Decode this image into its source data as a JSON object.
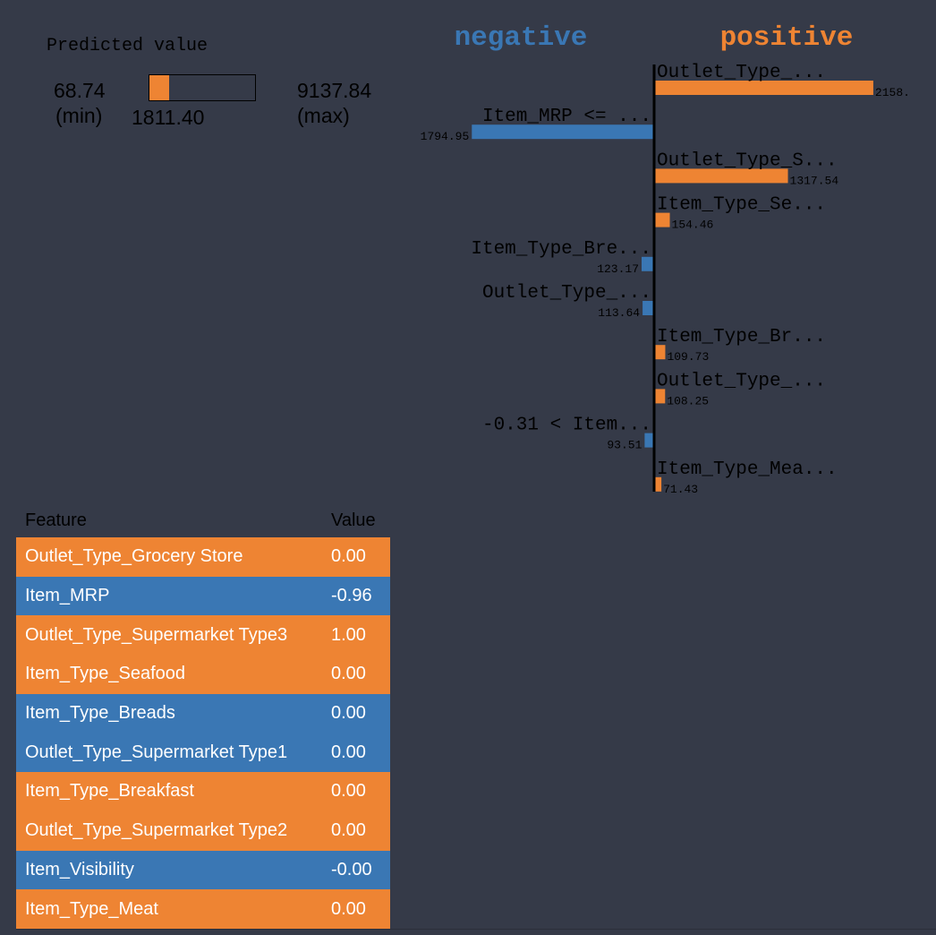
{
  "colors": {
    "negative": "#3a77b4",
    "positive": "#ee8433",
    "background": "#353a48"
  },
  "predicted": {
    "title": "Predicted value",
    "min_value": "68.74",
    "min_label": "(min)",
    "max_value": "9137.84",
    "max_label": "(max)",
    "value": "1811.40",
    "fraction": 0.19
  },
  "chart_data": {
    "type": "bar",
    "title": "",
    "legend": {
      "negative": "negative",
      "positive": "positive"
    },
    "features": [
      {
        "label": "Outlet_Type_...",
        "value": 2158,
        "value_label": "2158.",
        "side": "positive"
      },
      {
        "label": "Item_MRP <= ...",
        "value": -1794.95,
        "value_label": "1794.95",
        "side": "negative"
      },
      {
        "label": "Outlet_Type_S...",
        "value": 1317.54,
        "value_label": "1317.54",
        "side": "positive"
      },
      {
        "label": "Item_Type_Se...",
        "value": 154.46,
        "value_label": "154.46",
        "side": "positive"
      },
      {
        "label": "Item_Type_Bre...",
        "value": -123.17,
        "value_label": "123.17",
        "side": "negative"
      },
      {
        "label": "Outlet_Type_...",
        "value": -113.64,
        "value_label": "113.64",
        "side": "negative"
      },
      {
        "label": "Item_Type_Br...",
        "value": 109.73,
        "value_label": "109.73",
        "side": "positive"
      },
      {
        "label": "Outlet_Type_...",
        "value": 108.25,
        "value_label": "108.25",
        "side": "positive"
      },
      {
        "label": "-0.31 < Item...",
        "value": -93.51,
        "value_label": "93.51",
        "side": "negative"
      },
      {
        "label": "Item_Type_Mea...",
        "value": 71.43,
        "value_label": "71.43",
        "side": "positive"
      }
    ]
  },
  "table": {
    "headers": {
      "feature": "Feature",
      "value": "Value"
    },
    "rows": [
      {
        "feature": "Outlet_Type_Grocery Store",
        "value": "0.00",
        "side": "positive"
      },
      {
        "feature": "Item_MRP",
        "value": "-0.96",
        "side": "negative"
      },
      {
        "feature": "Outlet_Type_Supermarket Type3",
        "value": "1.00",
        "side": "positive"
      },
      {
        "feature": "Item_Type_Seafood",
        "value": "0.00",
        "side": "positive"
      },
      {
        "feature": "Item_Type_Breads",
        "value": "0.00",
        "side": "negative"
      },
      {
        "feature": "Outlet_Type_Supermarket Type1",
        "value": "0.00",
        "side": "negative"
      },
      {
        "feature": "Item_Type_Breakfast",
        "value": "0.00",
        "side": "positive"
      },
      {
        "feature": "Outlet_Type_Supermarket Type2",
        "value": "0.00",
        "side": "positive"
      },
      {
        "feature": "Item_Visibility",
        "value": "-0.00",
        "side": "negative"
      },
      {
        "feature": "Item_Type_Meat",
        "value": "0.00",
        "side": "positive"
      }
    ]
  }
}
